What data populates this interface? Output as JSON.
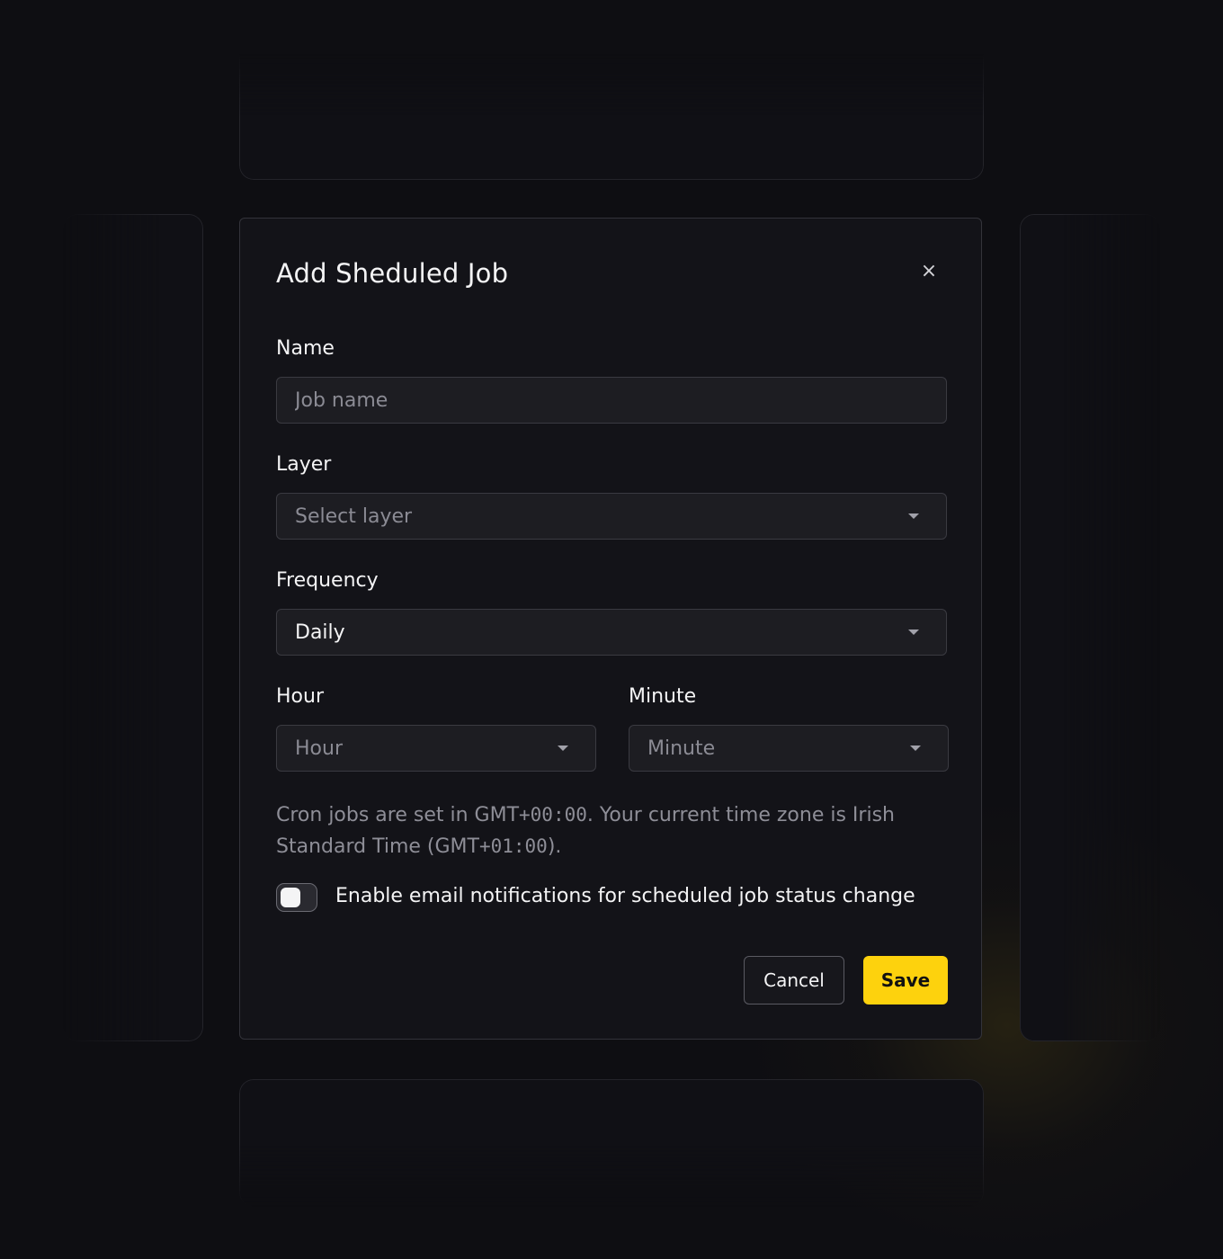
{
  "modal": {
    "title": "Add Sheduled Job",
    "close_icon": "×"
  },
  "form": {
    "name": {
      "label": "Name",
      "placeholder": "Job name",
      "value": ""
    },
    "layer": {
      "label": "Layer",
      "placeholder": "Select layer"
    },
    "frequency": {
      "label": "Frequency",
      "value": "Daily"
    },
    "hour": {
      "label": "Hour",
      "placeholder": "Hour"
    },
    "minute": {
      "label": "Minute",
      "placeholder": "Minute"
    },
    "info": {
      "part1": "Cron jobs are set in GMT",
      "offset1": "+00:00",
      "part2": ".  Your current time zone is Irish Standard Time (GMT",
      "offset2": "+01:00",
      "part3": ")."
    },
    "notifications": {
      "label": "Enable email notifications for scheduled job status change",
      "enabled": false
    }
  },
  "actions": {
    "cancel_label": "Cancel",
    "save_label": "Save"
  },
  "colors": {
    "accent": "#fdd20d",
    "background": "#0e0e12",
    "modal": "#131318"
  },
  "icons": {
    "close": "close-icon",
    "dropdown": "caret-down-icon"
  }
}
